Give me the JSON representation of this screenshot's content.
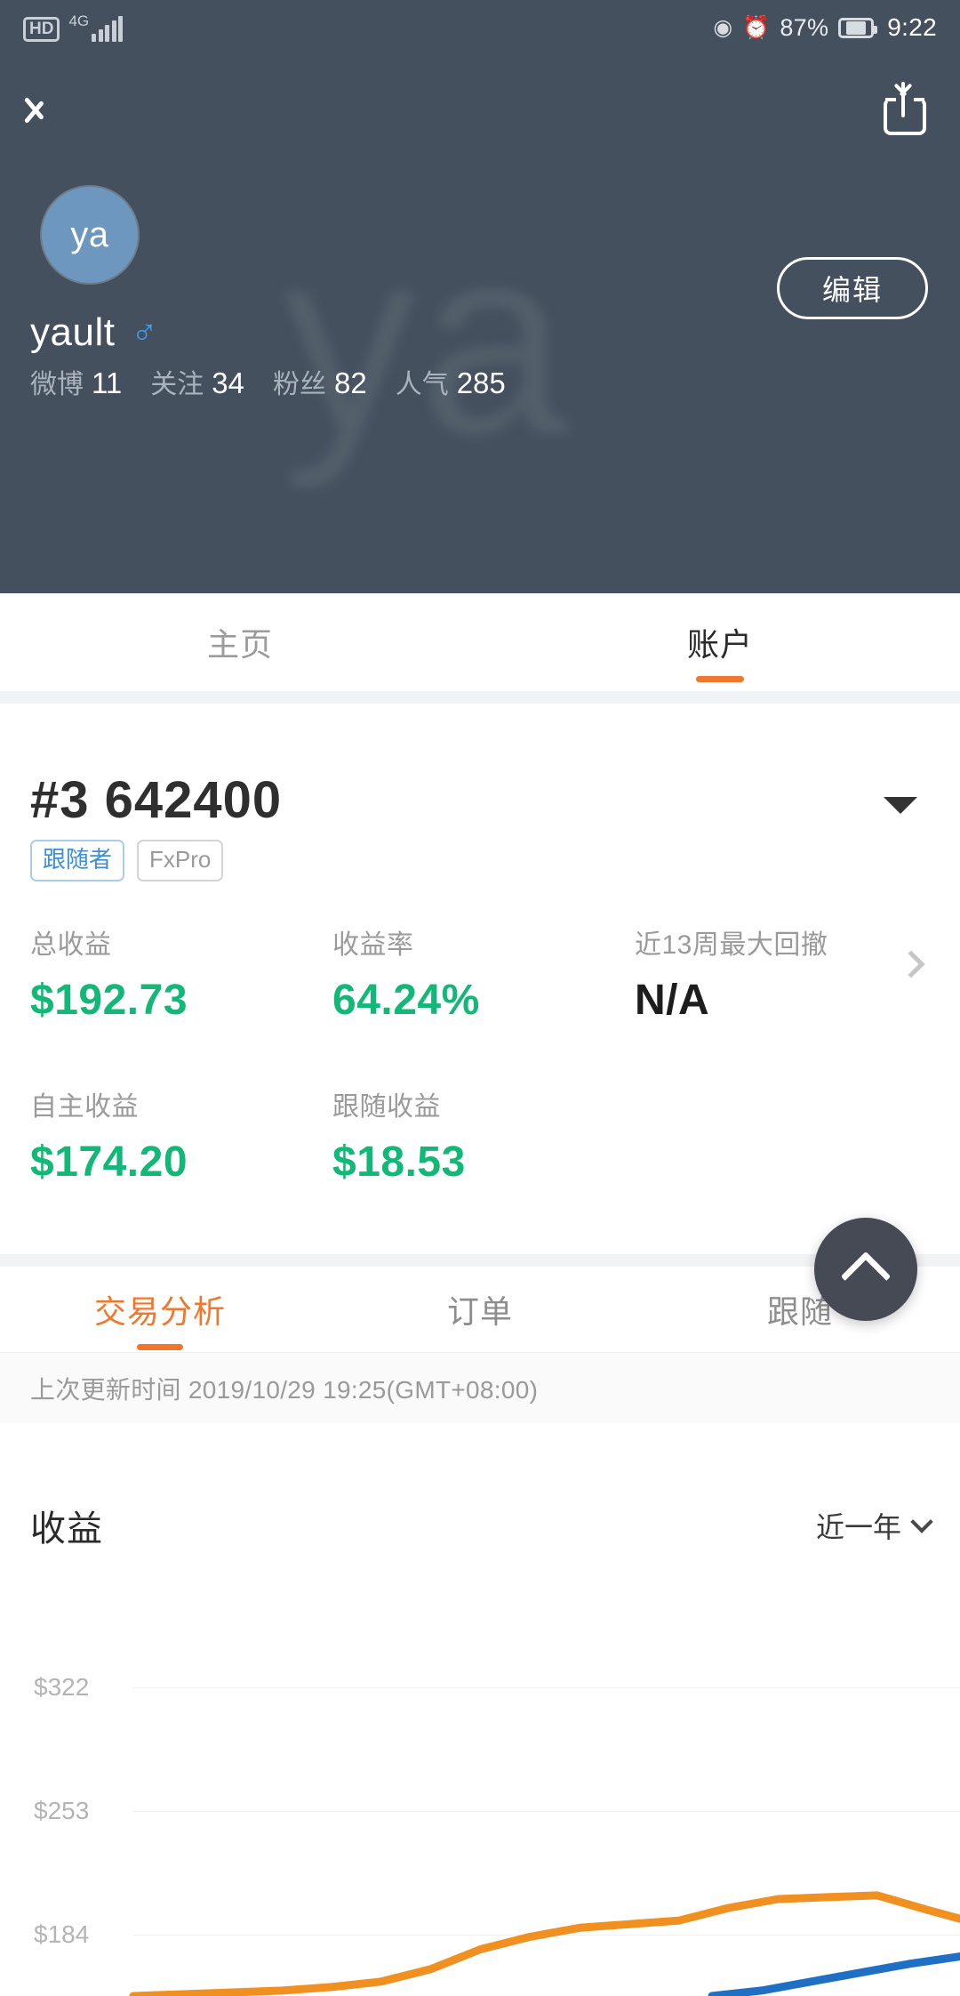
{
  "statusbar": {
    "hd": "HD",
    "network": "4G",
    "battery": "87%",
    "time": "9:22",
    "eye_icon": "eye-icon",
    "alarm_icon": "alarm-icon"
  },
  "nav": {
    "back_icon": "back-chevron-icon",
    "share_icon": "share-icon"
  },
  "profile": {
    "avatar_initials": "ya",
    "watermark": "ya",
    "username": "yault",
    "gender_symbol": "♂",
    "edit_label": "编辑",
    "stats": [
      {
        "label": "微博",
        "value": "11"
      },
      {
        "label": "关注",
        "value": "34"
      },
      {
        "label": "粉丝",
        "value": "82"
      },
      {
        "label": "人气",
        "value": "285"
      }
    ]
  },
  "top_tabs": [
    {
      "label": "主页",
      "active": false
    },
    {
      "label": "账户",
      "active": true
    }
  ],
  "account": {
    "number": "#3 642400",
    "badges": [
      {
        "label": "跟随者",
        "style": "blue"
      },
      {
        "label": "FxPro",
        "style": "gray"
      }
    ],
    "metrics_row1": [
      {
        "label": "总收益",
        "value": "$192.73",
        "color": "green"
      },
      {
        "label": "收益率",
        "value": "64.24%",
        "color": "green"
      },
      {
        "label": "近13周最大回撤",
        "value": "N/A",
        "color": "dark"
      }
    ],
    "metrics_row2": [
      {
        "label": "自主收益",
        "value": "$174.20",
        "color": "green"
      },
      {
        "label": "跟随收益",
        "value": "$18.53",
        "color": "green"
      }
    ],
    "expand_icon": "caret-down-icon",
    "detail_icon": "chevron-right-icon"
  },
  "sub_tabs": [
    {
      "label": "交易分析",
      "active": true
    },
    {
      "label": "订单",
      "active": false
    },
    {
      "label": "跟随",
      "active": false
    }
  ],
  "updated_text": "上次更新时间 2019/10/29 19:25(GMT+08:00)",
  "chart_panel": {
    "title": "收益",
    "range_label": "近一年",
    "range_icon": "chevron-down-icon"
  },
  "fab": {
    "icon": "chevron-up-icon"
  },
  "colors": {
    "header_bg": "#44505e",
    "accent_orange": "#f0772b",
    "green": "#12b877",
    "badge_blue": "#3a8fd6",
    "series_orange": "#f09020",
    "series_blue": "#1f6fc4"
  },
  "chart_data": {
    "type": "line",
    "title": "收益",
    "xlabel": "",
    "ylabel": "",
    "ylim": [
      150,
      356
    ],
    "yticks": [
      322,
      253,
      184
    ],
    "ytick_labels": [
      "$322",
      "$253",
      "$184"
    ],
    "grid": true,
    "legend": "none",
    "series": [
      {
        "name": "总收益",
        "color": "#f09020",
        "x": [
          0,
          6,
          12,
          18,
          24,
          30,
          36,
          42,
          48,
          54,
          60,
          66,
          72,
          78,
          84,
          90,
          96,
          100
        ],
        "values": [
          150,
          151,
          152,
          153,
          155,
          158,
          165,
          176,
          183,
          188,
          190,
          192,
          199,
          204,
          205,
          206,
          198,
          193
        ]
      },
      {
        "name": "跟随收益",
        "color": "#1f6fc4",
        "x": [
          70,
          76,
          82,
          88,
          94,
          100
        ],
        "values": [
          150,
          153,
          158,
          163,
          168,
          172
        ]
      }
    ]
  }
}
